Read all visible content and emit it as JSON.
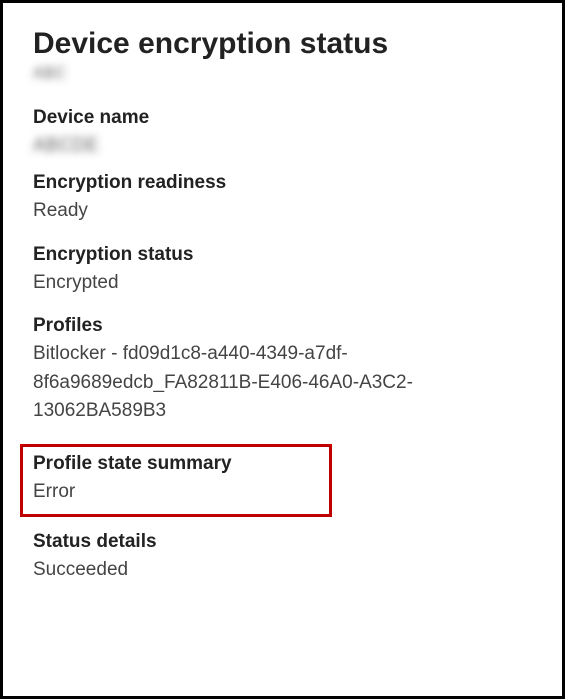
{
  "page": {
    "title": "Device encryption status",
    "subtitle_redacted": "ABC",
    "fields": {
      "device_name": {
        "label": "Device name",
        "value_redacted": "ABCDE"
      },
      "encryption_readiness": {
        "label": "Encryption readiness",
        "value": "Ready"
      },
      "encryption_status": {
        "label": "Encryption status",
        "value": "Encrypted"
      },
      "profiles": {
        "label": "Profiles",
        "value": "Bitlocker - fd09d1c8-a440-4349-a7df-8f6a9689edcb_FA82811B-E406-46A0-A3C2-13062BA589B3"
      },
      "profile_state_summary": {
        "label": "Profile state summary",
        "value": "Error"
      },
      "status_details": {
        "label": "Status details",
        "value": "Succeeded"
      }
    }
  },
  "highlight": {
    "color": "#c00000",
    "target": "profile_state_summary"
  }
}
